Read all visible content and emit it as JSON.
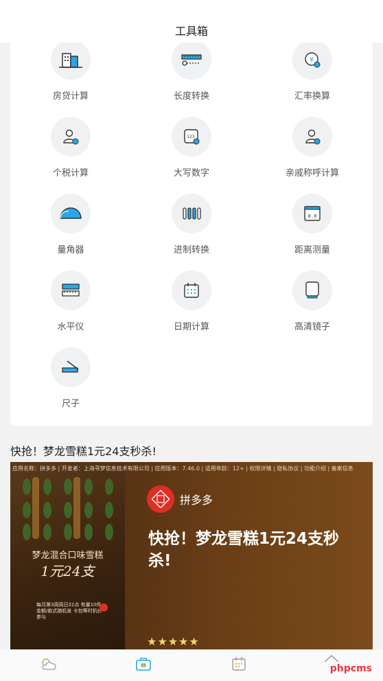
{
  "header": {
    "title": "工具箱"
  },
  "tools": [
    {
      "label": "房贷计算",
      "icon": "building-icon"
    },
    {
      "label": "长度转换",
      "icon": "ruler-icon"
    },
    {
      "label": "汇率换算",
      "icon": "currency-icon"
    },
    {
      "label": "个税计算",
      "icon": "person-tax-icon"
    },
    {
      "label": "大写数字",
      "icon": "number-icon"
    },
    {
      "label": "亲戚称呼计算",
      "icon": "relatives-icon"
    },
    {
      "label": "量角器",
      "icon": "protractor-icon"
    },
    {
      "label": "进制转换",
      "icon": "binary-icon"
    },
    {
      "label": "距离测量",
      "icon": "distance-icon"
    },
    {
      "label": "水平仪",
      "icon": "level-icon"
    },
    {
      "label": "日期计算",
      "icon": "calendar-icon"
    },
    {
      "label": "高清镜子",
      "icon": "mirror-icon"
    },
    {
      "label": "尺子",
      "icon": "ruler-pencil-icon"
    }
  ],
  "promo": {
    "title": "快抢！梦龙雪糕1元24支秒杀!",
    "ad": {
      "meta": "应用名称：拼多多 | 开发者：上海寻梦信息技术有限公司 | 应用版本：7.46.0 | 适用年龄：12+ | 权限详情 | 隐私协议 | 功能介绍 | 备案信息",
      "brand": "拼多多",
      "headline": "快抢！梦龙雪糕1元24支秒杀!",
      "left_line1": "梦龙混合口味雪糕",
      "left_line2": "1元24支",
      "left_small": "每月第3周周日22点 有量10件 金额/款式随机发 卡包等时机价参与",
      "stars": "★★★★★"
    }
  },
  "tabbar": {
    "tabs": [
      {
        "name": "weather",
        "icon": "weather-icon",
        "active": false
      },
      {
        "name": "toolbox",
        "icon": "toolbox-icon",
        "active": true
      },
      {
        "name": "calendar",
        "icon": "calendar-tab-icon",
        "active": false
      },
      {
        "name": "home",
        "icon": "home-icon",
        "active": false
      }
    ],
    "watermark": "phpcms"
  },
  "colors": {
    "accent": "#2aa7e8",
    "brand_red": "#e02e24",
    "star": "#f2d56d"
  }
}
